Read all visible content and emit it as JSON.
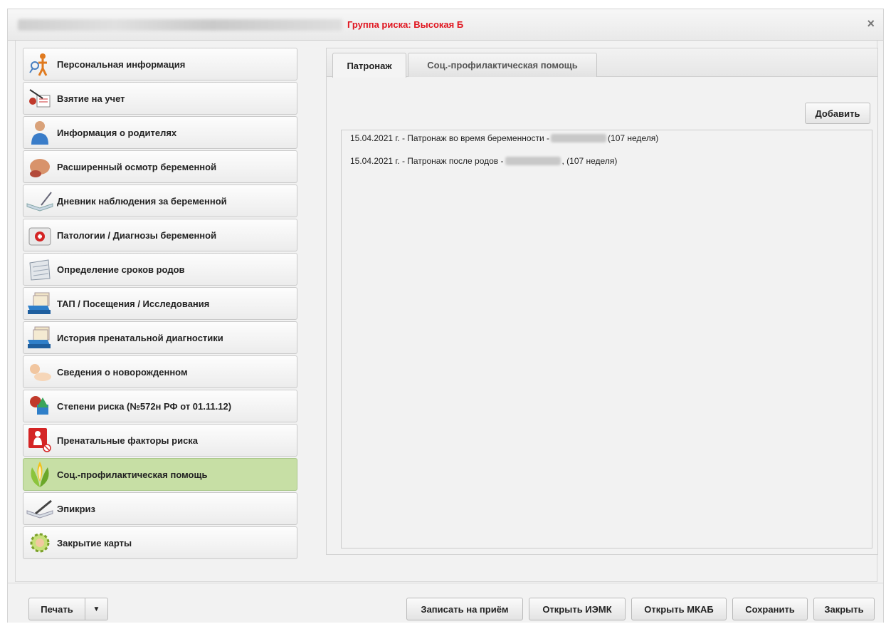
{
  "window": {
    "risk_group": "Группа риска: Высокая Б",
    "close_symbol": "×"
  },
  "sidebar": {
    "items": [
      {
        "label": "Персональная информация",
        "icon": "person-info-icon"
      },
      {
        "label": "Взятие на учет",
        "icon": "registration-icon"
      },
      {
        "label": "Информация о родителях",
        "icon": "parents-icon"
      },
      {
        "label": "Расширенный осмотр беременной",
        "icon": "exam-icon"
      },
      {
        "label": "Дневник наблюдения за беременной",
        "icon": "diary-icon"
      },
      {
        "label": "Патологии / Диагнозы беременной",
        "icon": "pathology-icon"
      },
      {
        "label": "Определение сроков родов",
        "icon": "calendar-icon"
      },
      {
        "label": "ТАП / Посещения / Исследования",
        "icon": "cardfile-icon"
      },
      {
        "label": "История пренатальной диагностики",
        "icon": "cardfile-icon"
      },
      {
        "label": "Сведения о новорожденном",
        "icon": "newborn-icon"
      },
      {
        "label": "Степени риска (№572н РФ от 01.11.12)",
        "icon": "risk-icon"
      },
      {
        "label": "Пренатальные факторы риска",
        "icon": "prenatal-risk-icon"
      },
      {
        "label": "Соц.-профилактическая помощь",
        "icon": "social-help-icon",
        "active": true
      },
      {
        "label": "Эпикриз",
        "icon": "pen-icon"
      },
      {
        "label": "Закрытие карты",
        "icon": "close-card-icon"
      }
    ]
  },
  "panel": {
    "tabs": [
      {
        "label": "Патронаж",
        "active": true
      },
      {
        "label": "Соц.-профилактическая помощь",
        "active": false
      }
    ],
    "add_label": "Добавить",
    "records": [
      {
        "before": "15.04.2021 г. - Патронаж во время беременности -",
        "after": "(107 неделя)"
      },
      {
        "before": "15.04.2021 г. - Патронаж после родов -",
        "after": ", (107 неделя)"
      }
    ]
  },
  "footer": {
    "print_label": "Печать",
    "dropdown_symbol": "▼",
    "appointment_label": "Записать на приём",
    "open_iemk_label": "Открыть ИЭМК",
    "open_mkab_label": "Открыть МКАБ",
    "save_label": "Сохранить",
    "close_label": "Закрыть"
  },
  "colors": {
    "risk_text": "#e0141e",
    "active_nav": "#c7dfa5"
  }
}
